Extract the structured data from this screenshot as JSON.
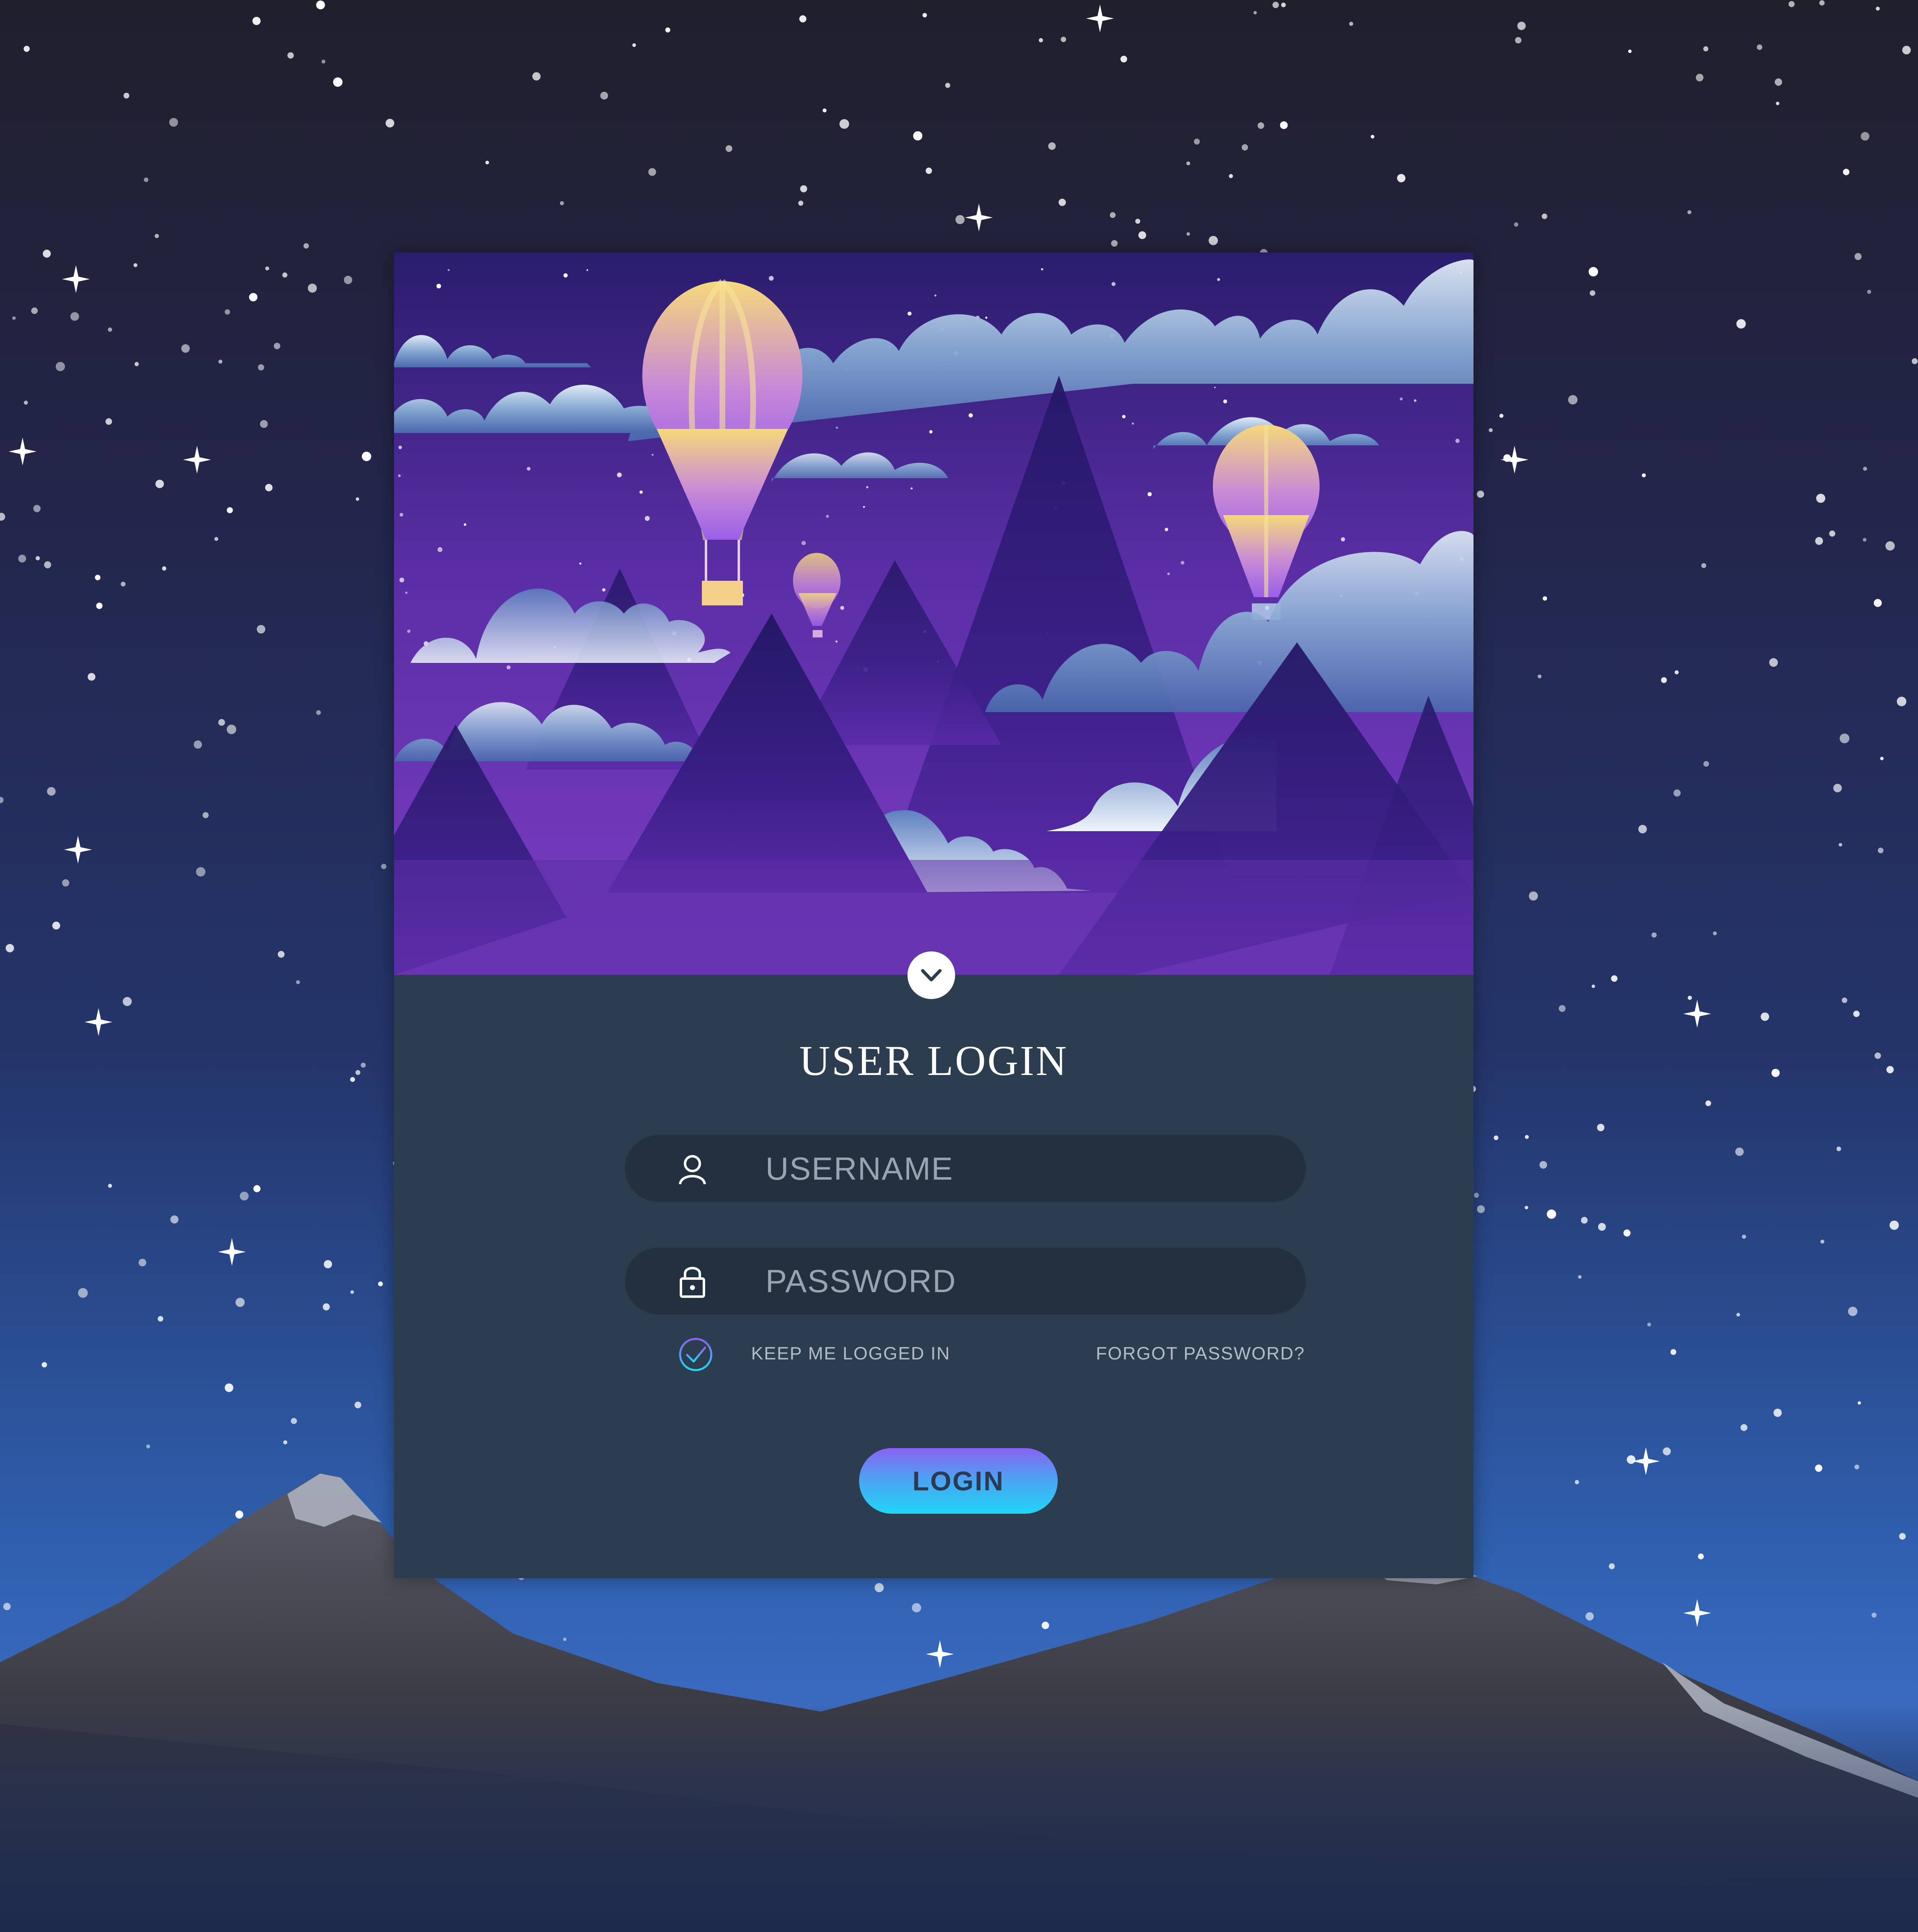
{
  "login_card": {
    "title": "USER LOGIN",
    "username": {
      "placeholder": "USERNAME",
      "value": "",
      "icon": "user-icon"
    },
    "password": {
      "placeholder": "PASSWORD",
      "value": "",
      "icon": "lock-icon"
    },
    "remember": {
      "label": "KEEP ME LOGGED IN",
      "checked": true,
      "icon": "check-circle-icon"
    },
    "forgot_password": "FORGOT PASSWORD?",
    "login_button": "LOGIN",
    "toggle_icon": "chevron-down-icon"
  },
  "colors": {
    "card_background": "#2d3d50",
    "field_background": "#223040",
    "button_gradient": [
      "#8a62f0",
      "#4f9ff2",
      "#1fd6f7"
    ],
    "hero_purple": "#6a35b8",
    "night_sky": "#24356b"
  }
}
